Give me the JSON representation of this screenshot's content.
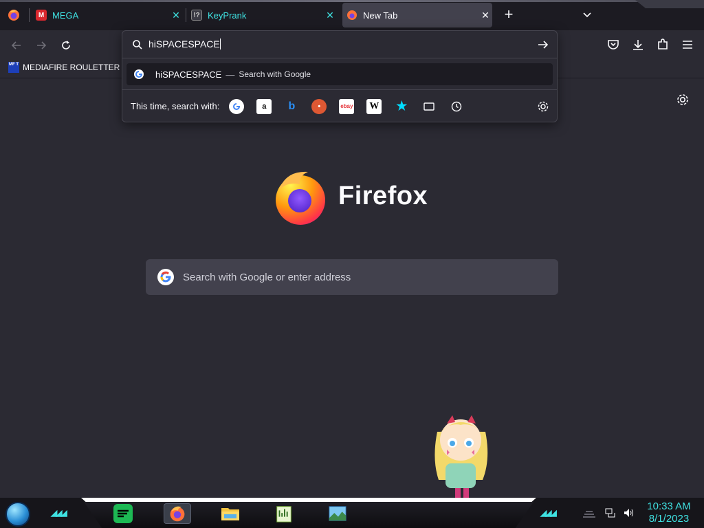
{
  "tabs": [
    {
      "label": "MEGA",
      "icon": "mega-icon"
    },
    {
      "label": "KeyPrank",
      "icon": "keyprank-icon"
    },
    {
      "label": "New Tab",
      "icon": "firefox-icon"
    }
  ],
  "tab_glyphs": {
    "close": "✕",
    "new_tab": "+"
  },
  "bookmarks": [
    {
      "label": "MEDIAFIRE ROULETTER",
      "icon_text": "MF T"
    }
  ],
  "urlbar": {
    "value": "hiSPACESPACE",
    "suggestion": {
      "text": "hiSPACESPACE",
      "separator": "—",
      "hint": "Search with Google"
    },
    "search_with_label": "This time, search with:",
    "engines": [
      "google-icon",
      "amazon-icon",
      "bing-icon",
      "duckduckgo-icon",
      "ebay-icon",
      "wikipedia-icon",
      "bookmarks-icon",
      "tabs-icon",
      "history-icon"
    ]
  },
  "newtab": {
    "wordmark": "Firefox",
    "search_placeholder": "Search with Google or enter address"
  },
  "taskbar": {
    "clock_time": "10:33 AM",
    "clock_date": "8/1/2023",
    "apps": [
      "spotify-icon",
      "firefox-icon",
      "file-explorer-icon",
      "audio-editor-icon",
      "photos-icon"
    ]
  },
  "colors": {
    "accent": "#3fe1e1",
    "bg": "#2b2a33",
    "panel": "#42414d"
  }
}
